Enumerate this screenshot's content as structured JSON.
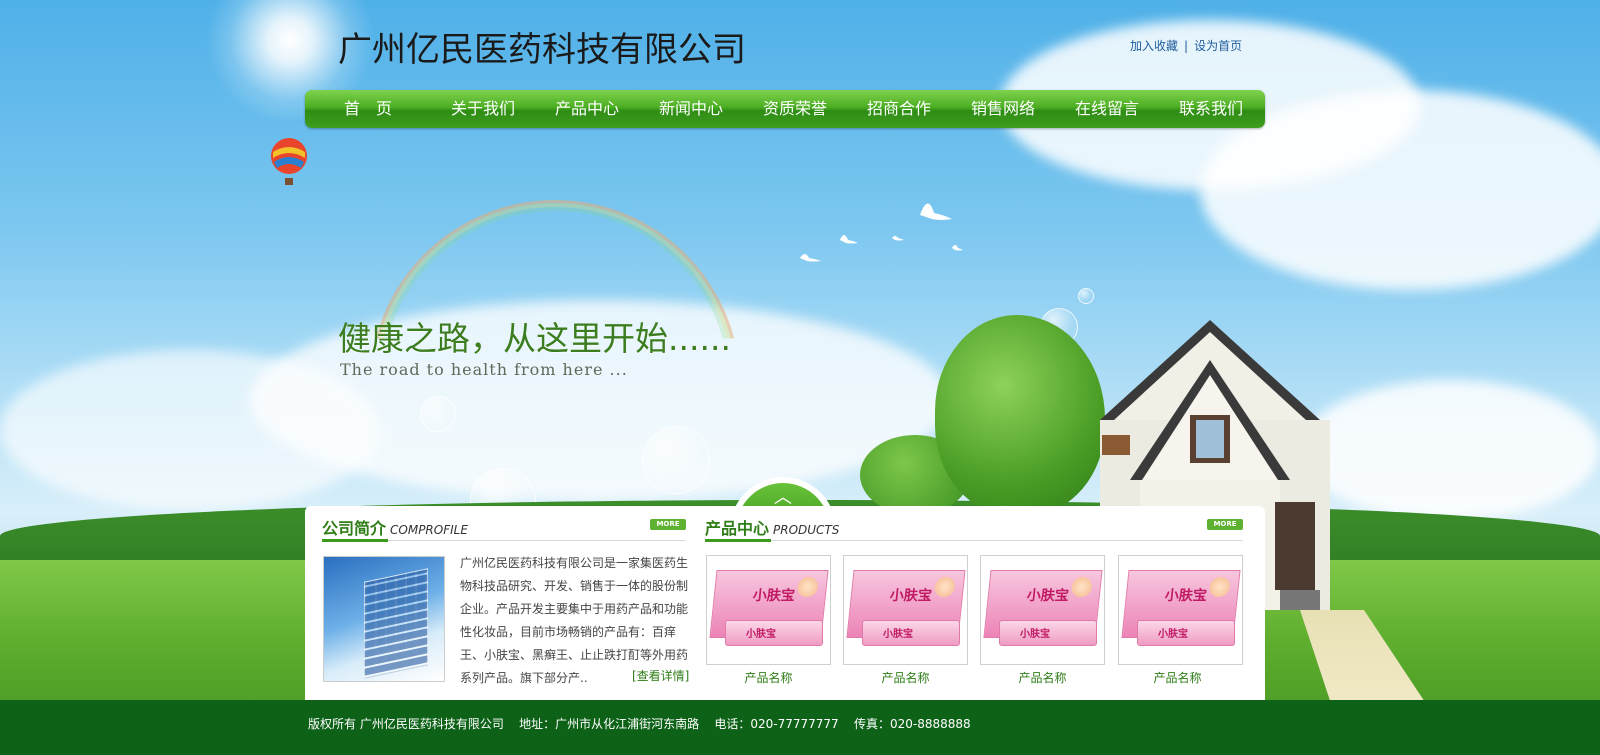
{
  "header": {
    "company_name": "广州亿民医药科技有限公司",
    "links": [
      "加入收藏",
      "设为首页"
    ],
    "link_separator": "|"
  },
  "nav": {
    "items": [
      "首　页",
      "关于我们",
      "产品中心",
      "新闻中心",
      "资质荣誉",
      "招商合作",
      "销售网络",
      "在线留言",
      "联系我们"
    ]
  },
  "banner": {
    "slogan": "健康之路，从这里开始......",
    "slogan_en": "The road to health from here ..."
  },
  "toggle": {
    "icon": "chevron-up-icon",
    "glyph": "︿"
  },
  "about": {
    "title": "公司简介",
    "subtitle": "COMPROFILE",
    "more": "MORE",
    "text": "广州亿民医药科技有限公司是一家集医药生物科技品研究、开发、销售于一体的股份制企业。产品开发主要集中于用药产品和功能性化妆品，目前市场畅销的产品有：百痒王、小肤宝、黑癣王、止止跌打酊等外用药系列产品。旗下部分产..",
    "detail_link": "[查看详情]"
  },
  "products": {
    "title": "产品中心",
    "subtitle": "PRODUCTS",
    "more": "MORE",
    "items": [
      {
        "name": "产品名称",
        "brand": "小肤宝"
      },
      {
        "name": "产品名称",
        "brand": "小肤宝"
      },
      {
        "name": "产品名称",
        "brand": "小肤宝"
      },
      {
        "name": "产品名称",
        "brand": "小肤宝"
      }
    ]
  },
  "footer": {
    "copyright": "版权所有  广州亿民医药科技有限公司",
    "address": "地址：广州市从化江浦街河东南路",
    "phone": "电话：020-77777777",
    "fax": "传真：020-8888888"
  },
  "colors": {
    "nav_green": "#3e9e1e",
    "footer_green": "#0d6217",
    "title_green": "#2f7d17",
    "link_blue": "#1f5c9b"
  }
}
